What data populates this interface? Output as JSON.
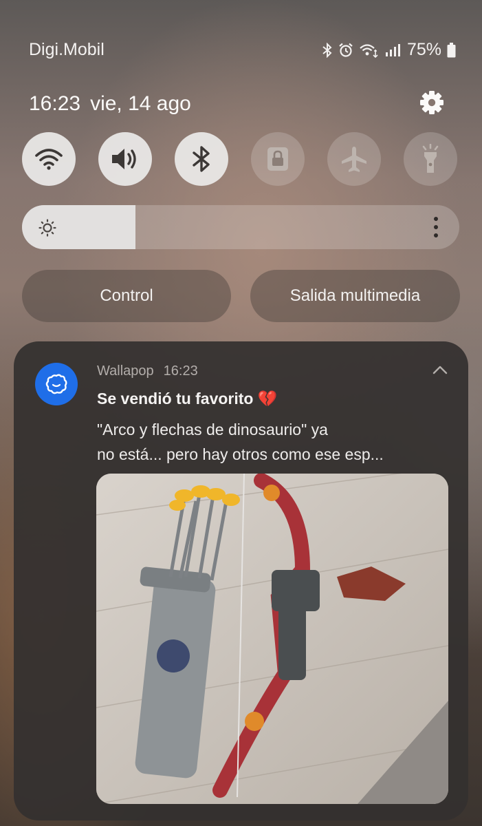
{
  "status_bar": {
    "carrier": "Digi.Mobil",
    "battery_percent": "75%",
    "icons": [
      "bluetooth-icon",
      "alarm-icon",
      "wifi-calling-icon",
      "signal-icon",
      "battery-icon"
    ]
  },
  "header": {
    "time": "16:23",
    "date": "vie, 14 ago",
    "settings_icon": "gear-icon"
  },
  "quick_toggles": [
    {
      "name": "wifi",
      "icon": "wifi-icon",
      "state": "on"
    },
    {
      "name": "sound",
      "icon": "speaker-icon",
      "state": "on"
    },
    {
      "name": "bluetooth",
      "icon": "bluetooth-icon",
      "state": "on"
    },
    {
      "name": "rotation-lock",
      "icon": "lock-icon",
      "state": "off"
    },
    {
      "name": "airplane-mode",
      "icon": "airplane-icon",
      "state": "off"
    },
    {
      "name": "flashlight",
      "icon": "flashlight-icon",
      "state": "off"
    }
  ],
  "brightness": {
    "level": 0.26,
    "icon": "sun-icon"
  },
  "buttons": {
    "control_label": "Control",
    "media_output_label": "Salida multimedia"
  },
  "notification": {
    "app_name": "Wallapop",
    "time": "16:23",
    "title": "Se vendió tu favorito",
    "title_emoji": "💔",
    "body_line1": "\"Arco y flechas de dinosaurio\" ya",
    "body_line2": "no está... pero hay otros como ese esp...",
    "accent_color": "#1f6ee8"
  },
  "colors": {
    "toggle_on": "#ecebe9",
    "toggle_off_icon": "#bdb4ae",
    "notification_background": "#34302f"
  }
}
